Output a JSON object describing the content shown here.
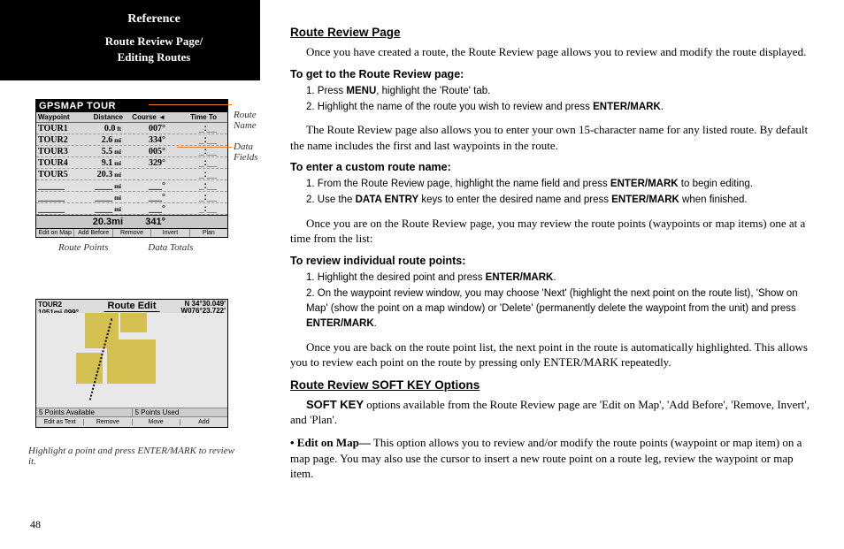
{
  "sidebar": {
    "reference": "Reference",
    "subtitle1": "Route Review Page/",
    "subtitle2": "Editing Routes"
  },
  "gps1": {
    "title": "GPSMAP TOUR",
    "headers": [
      "Waypoint",
      "Distance",
      "Course ◄",
      "Time To"
    ],
    "rows": [
      {
        "wp": "TOUR1",
        "dist": "0.0",
        "distU": "ft",
        "course": "007°",
        "time": "_:__"
      },
      {
        "wp": "TOUR2",
        "dist": "2.6",
        "distU": "mi",
        "course": "334°",
        "time": "_:__"
      },
      {
        "wp": "TOUR3",
        "dist": "5.5",
        "distU": "mi",
        "course": "005°",
        "time": "_:__"
      },
      {
        "wp": "TOUR4",
        "dist": "9.1",
        "distU": "mi",
        "course": "329°",
        "time": "_:__"
      },
      {
        "wp": "TOUR5",
        "dist": "20.3",
        "distU": "mi",
        "course": "",
        "time": "_:__"
      }
    ],
    "total_dist": "20.3mi",
    "total_course": "341°",
    "softkeys": [
      "Edit on Map",
      "Add Before",
      "Remove",
      "Invert",
      "Plan"
    ]
  },
  "anno": {
    "route_name_l1": "Route",
    "route_name_l2": "Name",
    "data_fields_l1": "Data",
    "data_fields_l2": "Fields",
    "route_points": "Route Points",
    "data_totals": "Data Totals"
  },
  "gps2": {
    "title": "Route Edit",
    "topleft_l1": "TOUR2",
    "topleft_l2": "1051mi   099°",
    "topright_l1": "N 34°30.049'",
    "topright_l2": "W076°23.722'",
    "status_left": "5  Points Available",
    "status_right": "5  Points Used",
    "softkeys": [
      "Edit as Text",
      "Remove",
      "Move",
      "Add"
    ]
  },
  "caption": "Highlight a point and press ENTER/MARK to review it.",
  "page_num": "48",
  "content": {
    "h_route_review": "Route Review Page",
    "p1": "Once you have created a route, the Route Review page allows you to review and modify the route displayed.",
    "sb_get": "To get to the Route Review page:",
    "s1_1a": "1.  Press ",
    "s1_1b": "MENU",
    "s1_1c": ", highlight the 'Route' tab.",
    "s1_2a": "2.  Highlight the name of the route you wish to review and press ",
    "s1_2b": "ENTER/MARK",
    "s1_2c": ".",
    "p2": "The Route Review page also allows you to enter your own 15-character name for any listed route. By default the name includes the first and last waypoints in the route.",
    "sb_name": "To enter a custom route name:",
    "s2_1a": "1.  From the Route Review page, highlight the name field and press ",
    "s2_1b": "ENTER/MARK",
    "s2_1c": " to begin editing.",
    "s2_2a": "2.  Use the ",
    "s2_2b": "DATA ENTRY",
    "s2_2c": "  keys to enter the desired name and press ",
    "s2_2d": "ENTER/MARK",
    "s2_2e": " when finished.",
    "p3": "Once you are on the Route Review page, you may review the route points (waypoints or map items) one at a time from the list:",
    "sb_review": "To review individual route points:",
    "s3_1a": "1.  Highlight the desired point and press ",
    "s3_1b": "ENTER/MARK",
    "s3_1c": ".",
    "s3_2a": "2.  On the waypoint review window, you may choose 'Next' (highlight the next point on the route list), 'Show on Map' (show the point on a map window) or 'Delete' (permanently delete the waypoint from the unit) and press ",
    "s3_2b": "ENTER/MARK",
    "s3_2c": ".",
    "p4": "Once you are back on the route point list, the next point in the route is automatically highlighted. This allows you to review each point on the route by pressing only ENTER/MARK repeatedly.",
    "h_softkey": "Route Review SOFT KEY Options",
    "p5a": "SOFT KEY",
    "p5b": " options available from the Route Review page are 'Edit on Map', 'Add Before', 'Remove, Invert', and 'Plan'.",
    "p6a": "• Edit on Map—",
    "p6b": " This option allows you to review and/or modify the route points (waypoint or map item) on a map page. You may also use the cursor to insert a new route point on a route leg, review the waypoint or map item."
  }
}
